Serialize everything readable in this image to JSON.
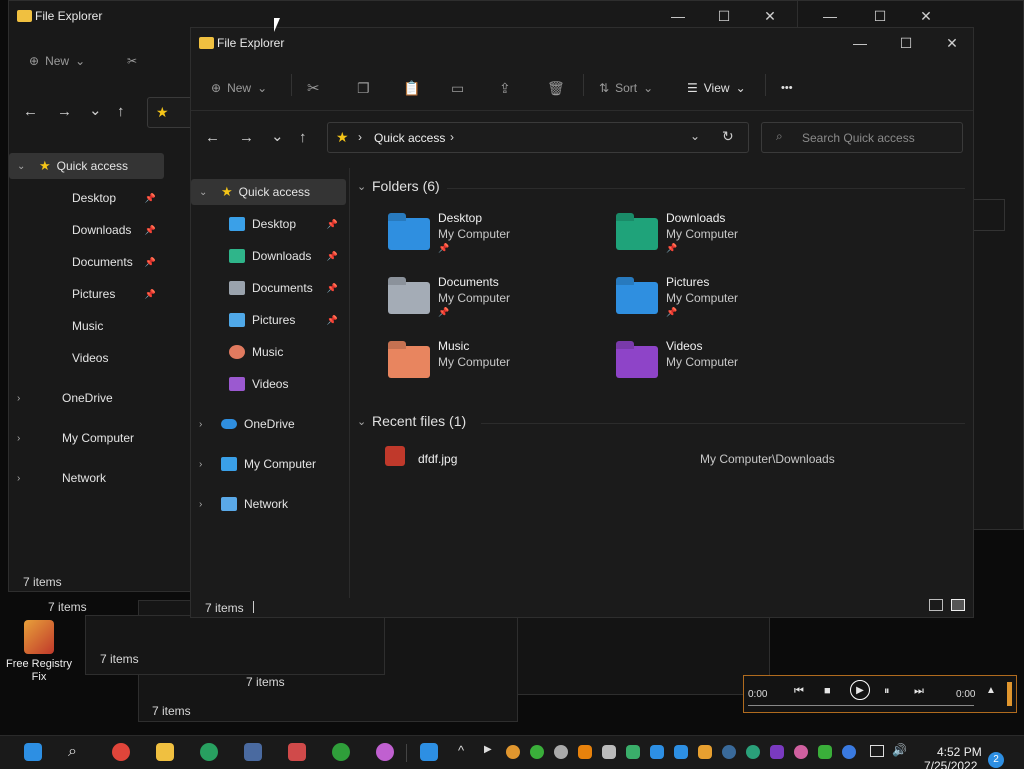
{
  "explorer": {
    "window_title": "File Explorer",
    "toolbar": {
      "new_label": "New",
      "sort_label": "Sort",
      "view_label": "View",
      "more_label": "•••"
    },
    "address": {
      "location": "Quick access",
      "search_placeholder": "Search Quick access"
    },
    "nav": {
      "quick_access": "Quick access",
      "items": [
        {
          "label": "Desktop",
          "icon": "desktop-icon",
          "pinned": true,
          "color": "#3aa0e8"
        },
        {
          "label": "Downloads",
          "icon": "downloads-icon",
          "pinned": true,
          "color": "#2fb58a"
        },
        {
          "label": "Documents",
          "icon": "documents-icon",
          "pinned": true,
          "color": "#9aa3ad"
        },
        {
          "label": "Pictures",
          "icon": "pictures-icon",
          "pinned": true,
          "color": "#4fa8e8"
        },
        {
          "label": "Music",
          "icon": "music-icon",
          "pinned": false,
          "color": "#e07a5f"
        },
        {
          "label": "Videos",
          "icon": "videos-icon",
          "pinned": false,
          "color": "#9b59d0"
        }
      ],
      "onedrive": "OneDrive",
      "my_computer": "My Computer",
      "network": "Network"
    },
    "folders_header": "Folders (6)",
    "folders": [
      {
        "name": "Desktop",
        "location": "My Computer",
        "pinned": true,
        "color": "#2f8fe0",
        "icon": "desktop-folder-icon"
      },
      {
        "name": "Downloads",
        "location": "My Computer",
        "pinned": true,
        "color": "#1fa37a",
        "icon": "downloads-folder-icon"
      },
      {
        "name": "Documents",
        "location": "My Computer",
        "pinned": true,
        "color": "#a4acb6",
        "icon": "documents-folder-icon"
      },
      {
        "name": "Pictures",
        "location": "My Computer",
        "pinned": true,
        "color": "#2f8fe0",
        "icon": "pictures-folder-icon"
      },
      {
        "name": "Music",
        "location": "My Computer",
        "pinned": false,
        "color": "#e8855f",
        "icon": "music-folder-icon"
      },
      {
        "name": "Videos",
        "location": "My Computer",
        "pinned": false,
        "color": "#8e44c8",
        "icon": "videos-folder-icon"
      }
    ],
    "recent_header": "Recent files (1)",
    "recent_files": [
      {
        "name": "dfdf.jpg",
        "path": "My Computer\\Downloads",
        "icon": "mario-image-icon"
      }
    ],
    "status": "7 items"
  },
  "background_status": [
    "7 items",
    "7 items",
    "7 items",
    "7 items",
    "7 items"
  ],
  "desktop": {
    "free_registry_label": "Free Registry Fix"
  },
  "media_player": {
    "elapsed": "0:00",
    "duration": "0:00"
  },
  "taskbar": {
    "time": "4:52 PM",
    "date": "7/25/2022",
    "notification_count": "2"
  }
}
